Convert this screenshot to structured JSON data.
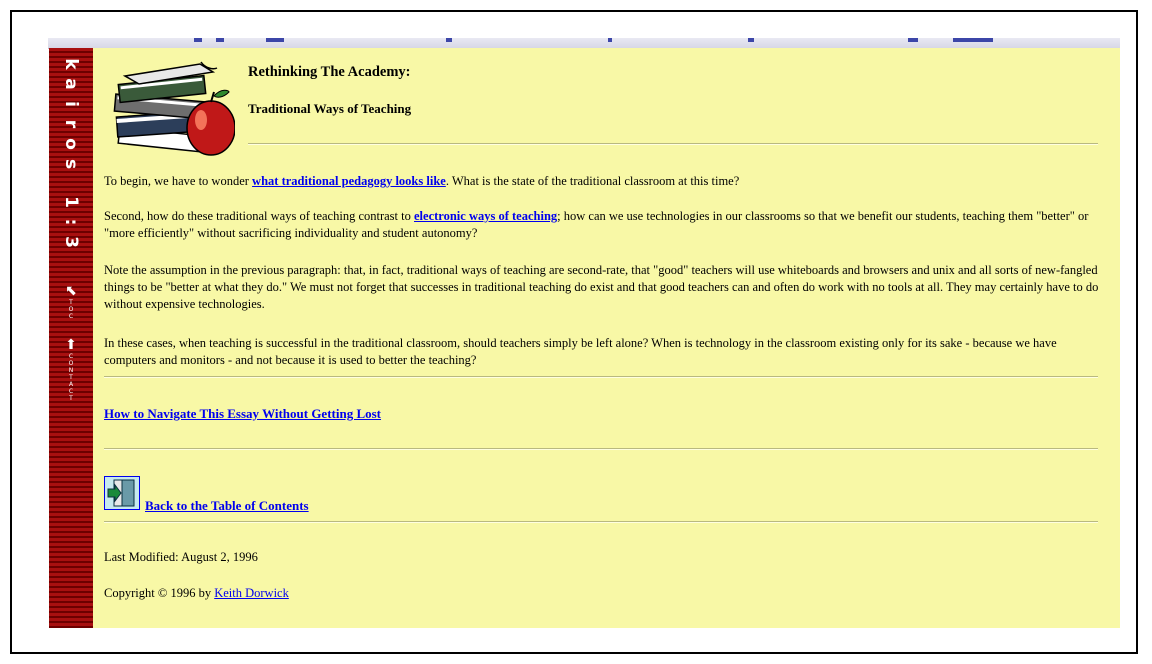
{
  "sidebar": {
    "brand_letters": [
      "k",
      "a",
      "i",
      "r",
      "o",
      "s",
      "",
      "1",
      ":",
      "3"
    ],
    "toc": {
      "arrow": "⬉",
      "label": "TOC"
    },
    "contact": {
      "arrow": "⬆",
      "label": "CONTACT"
    }
  },
  "header": {
    "title": "Rethinking The Academy:",
    "subtitle": "Traditional Ways of Teaching"
  },
  "body": {
    "p1": {
      "before": "To begin, we have to wonder ",
      "link": "what traditional pedagogy looks like",
      "after": ". What is the state of the traditional classroom at this time?"
    },
    "p2": {
      "before": "Second, how do these traditional ways of teaching contrast to ",
      "link": "electronic ways of teaching",
      "after": "; how can we use technologies in our classrooms so that we benefit our students, teaching them \"better\" or \"more efficiently\" without sacrificing individuality and student autonomy?"
    },
    "p3": "Note the assumption in the previous paragraph: that, in fact, traditional ways of teaching are second-rate, that \"good\" teachers will use whiteboards and browsers and unix and all sorts of new-fangled things to be \"better at what they do.\" We must not forget that successes in traditional teaching do exist and that good teachers can and often do work with no tools at all. They may certainly have to do without expensive technologies.",
    "p4": "In these cases, when teaching is successful in the traditional classroom, should teachers simply be left alone? When is technology in the classroom existing only for its sake - because we have computers and monitors - and not because it is used to better the teaching?"
  },
  "navigate_link": "How to Navigate This Essay Without Getting Lost",
  "back_link": "Back to the Table of Contents",
  "footer": {
    "modified": "Last Modified: August 2, 1996",
    "copyright_prefix": "Copyright © 1996 by ",
    "author": "Keith Dorwick"
  },
  "colors": {
    "page_background": "#f8f8a6",
    "sidebar": "#8c0000",
    "link": "#0000ee"
  }
}
